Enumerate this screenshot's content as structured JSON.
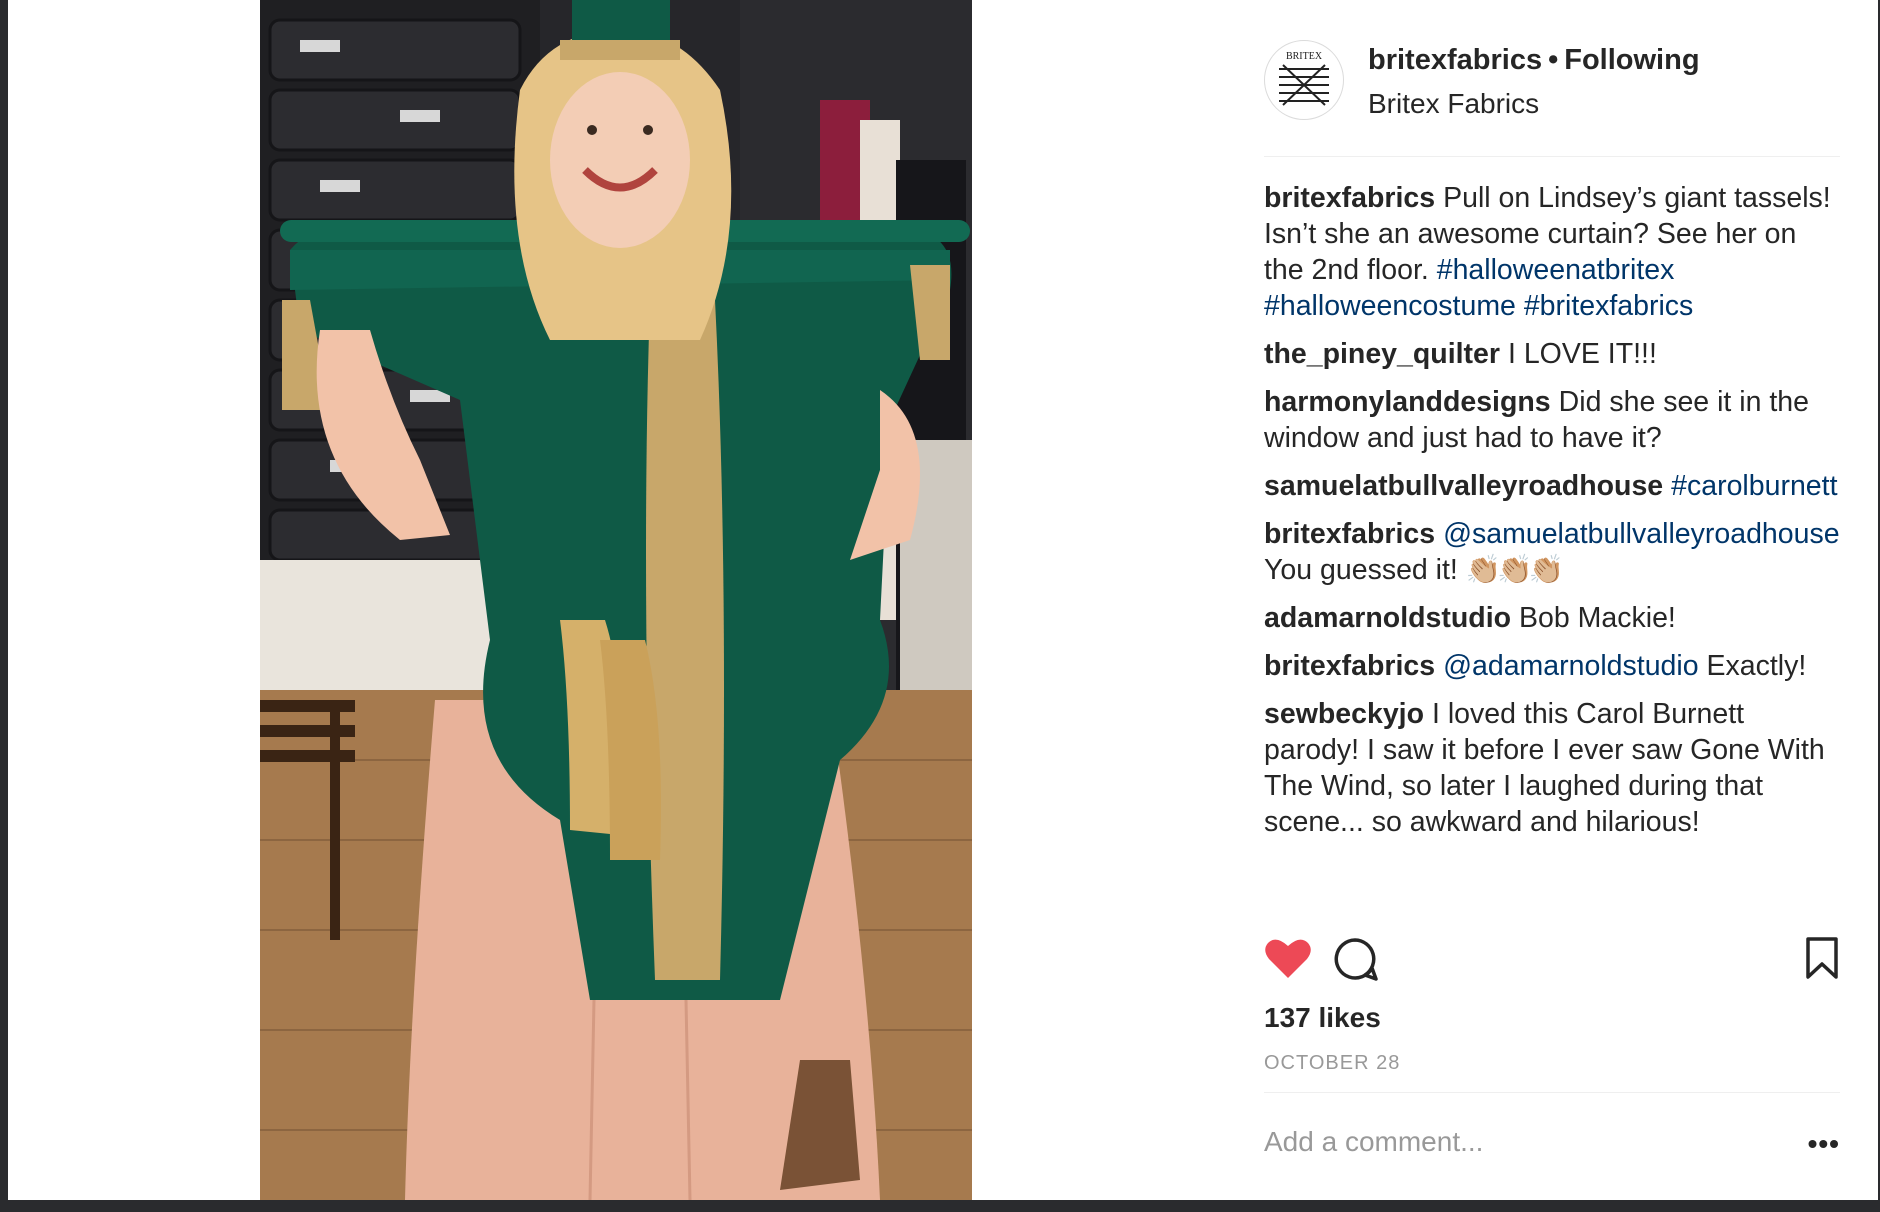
{
  "post": {
    "username": "britexfabrics",
    "following_label": "Following",
    "location": "Britex Fabrics",
    "avatar_text": "BRITEX"
  },
  "comments": [
    {
      "user": "britexfabrics",
      "text": "Pull on Lindsey’s giant tassels! Isn’t she an awesome curtain? See her on the 2nd floor.",
      "tags": "#halloweenatbritex #halloweencostume #britexfabrics"
    },
    {
      "user": "the_piney_quilter",
      "text": "I LOVE IT!!!"
    },
    {
      "user": "harmonylanddesigns",
      "text": "Did she see it in the window and just had to have it?"
    },
    {
      "user": "samuelatbullvalleyroadhouse",
      "mention": "#carolburnett"
    },
    {
      "user": "britexfabrics",
      "mention": "@samuelatbullvalleyroadhouse",
      "text": "You guessed it!",
      "emoji": "👏🏼👏🏼👏🏼"
    },
    {
      "user": "adamarnoldstudio",
      "text": "Bob Mackie!"
    },
    {
      "user": "britexfabrics",
      "mention": "@adamarnoldstudio",
      "text": "Exactly!"
    },
    {
      "user": "sewbeckyjo",
      "text": "I loved this Carol Burnett parody! I saw it before I ever saw Gone With The Wind, so later I laughed during that scene... so awkward and hilarious!"
    }
  ],
  "stats": {
    "likes": "137 likes",
    "date": "OCTOBER 28"
  },
  "composer": {
    "placeholder": "Add a comment...",
    "more": "•••"
  },
  "icons": {
    "like": "heart-icon",
    "comment": "comment-bubble-icon",
    "save": "bookmark-icon",
    "more": "ellipsis-icon"
  },
  "colors": {
    "liked_heart": "#ed4956",
    "link": "#003569",
    "text": "#262626",
    "muted": "#999999"
  }
}
